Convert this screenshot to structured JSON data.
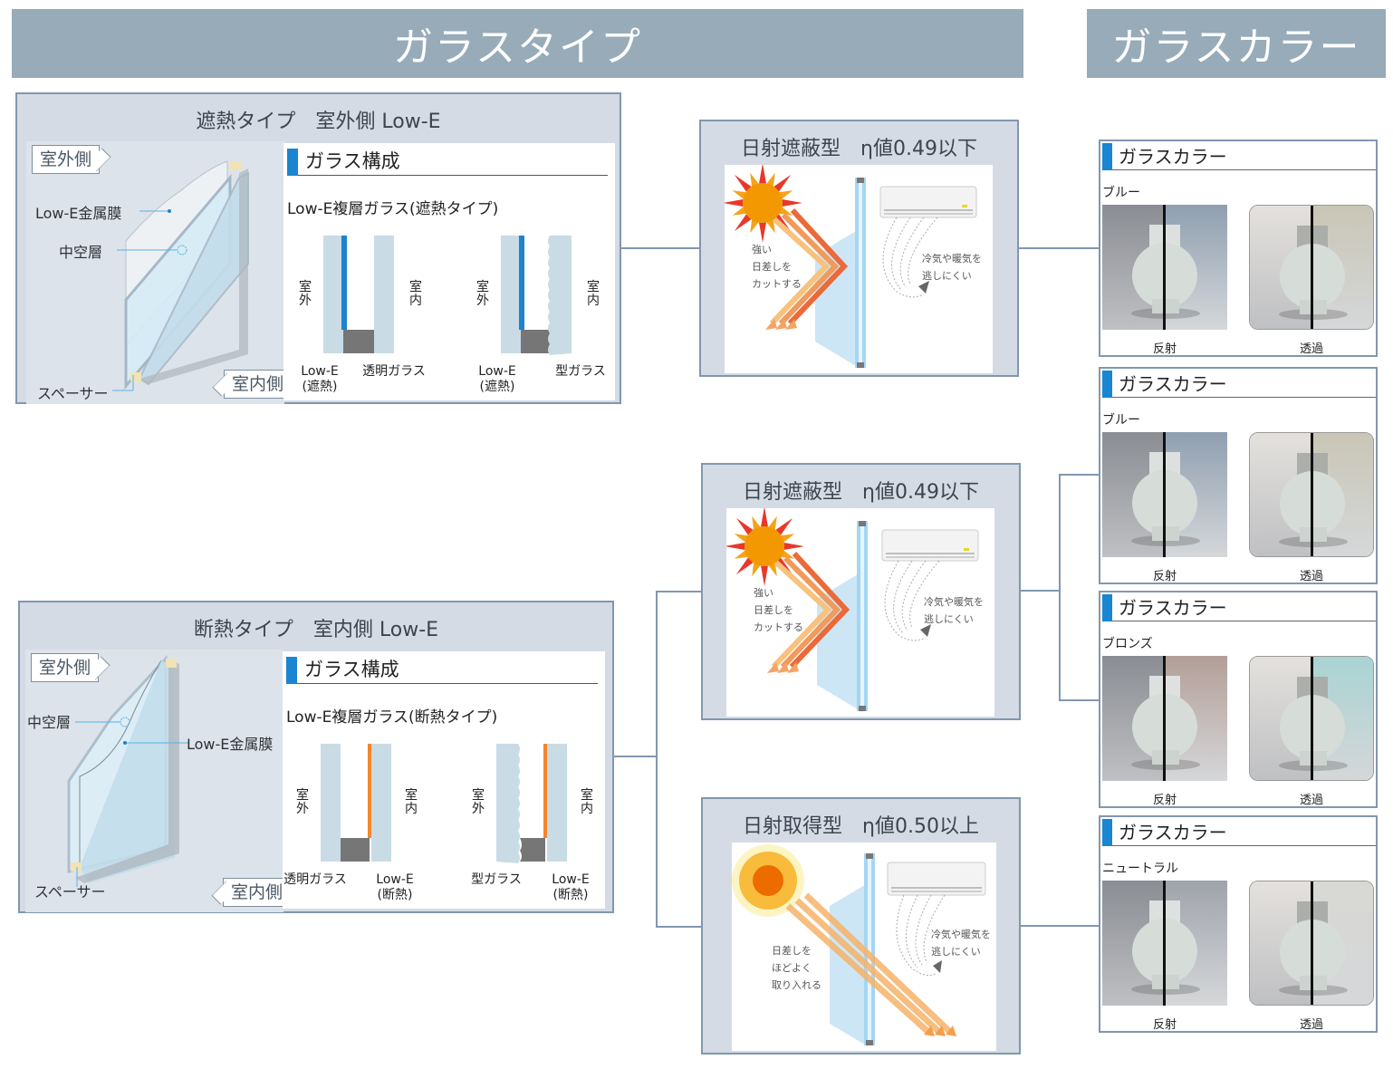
{
  "headers": {
    "glass_type": "ガラスタイプ",
    "glass_color": "ガラスカラー"
  },
  "type_panels": [
    {
      "title": "遮熱タイプ　室外側 Low-E",
      "illustration": {
        "outside_tag": "室外側",
        "inside_tag": "室内側",
        "labels": {
          "lowe_film": "Low-E金属膜",
          "air_layer": "中空層",
          "spacer": "スペーサー"
        }
      },
      "composition": {
        "heading": "ガラス構成",
        "subtitle": "Low-E複層ガラス(遮熱タイプ)",
        "coating_color": "#1e82cc",
        "diagrams": [
          {
            "outside": "室外",
            "inside": "室内",
            "left_label": "Low-E\n(遮熱)",
            "right_label": "透明ガラス",
            "left_line1": "Low-E",
            "left_line2": "(遮熱)",
            "right_line1": "透明ガラス",
            "right_line2": ""
          },
          {
            "outside": "室外",
            "inside": "室内",
            "left_line1": "Low-E",
            "left_line2": "(遮熱)",
            "right_line1": "型ガラス",
            "right_line2": ""
          }
        ]
      }
    },
    {
      "title": "断熱タイプ　室内側 Low-E",
      "illustration": {
        "outside_tag": "室外側",
        "inside_tag": "室内側",
        "labels": {
          "lowe_film": "Low-E金属膜",
          "air_layer": "中空層",
          "spacer": "スペーサー"
        }
      },
      "composition": {
        "heading": "ガラス構成",
        "subtitle": "Low-E複層ガラス(断熱タイプ)",
        "coating_color": "#f5862e",
        "diagrams": [
          {
            "outside": "室外",
            "inside": "室内",
            "left_line1": "透明ガラス",
            "left_line2": "",
            "right_line1": "Low-E",
            "right_line2": "(断熱)"
          },
          {
            "outside": "室外",
            "inside": "室内",
            "left_line1": "型ガラス",
            "left_line2": "",
            "right_line1": "Low-E",
            "right_line2": "(断熱)"
          }
        ]
      }
    }
  ],
  "effect_panels": [
    {
      "title": "日射遮蔽型　η値0.49以下",
      "sun_text": "強い\n日差しを\nカットする",
      "ac_text": "冷気や暖気を\n逃しにくい"
    },
    {
      "title": "日射遮蔽型　η値0.49以下",
      "sun_text": "強い\n日差しを\nカットする",
      "ac_text": "冷気や暖気を\n逃しにくい"
    },
    {
      "title": "日射取得型　η値0.50以上",
      "sun_text": "日差しを\nほどよく\n取り入れる",
      "ac_text": "冷気や暖気を\n逃しにくい"
    }
  ],
  "color_panels": [
    {
      "heading": "ガラスカラー",
      "color_name": "ブルー",
      "reflection_label": "反射",
      "transmission_label": "透過",
      "refl_tint": "#8f9fb0",
      "trans_tint": "#c9c6b6"
    },
    {
      "heading": "ガラスカラー",
      "color_name": "ブルー",
      "reflection_label": "反射",
      "transmission_label": "透過",
      "refl_tint": "#8f9fb0",
      "trans_tint": "#c9c6b6"
    },
    {
      "heading": "ガラスカラー",
      "color_name": "ブロンズ",
      "reflection_label": "反射",
      "transmission_label": "透過",
      "refl_tint": "#b39e98",
      "trans_tint": "#a9d3d3"
    },
    {
      "heading": "ガラスカラー",
      "color_name": "ニュートラル",
      "reflection_label": "反射",
      "transmission_label": "透過",
      "refl_tint": "#9fa3ab",
      "trans_tint": "#d8d8d4"
    }
  ]
}
